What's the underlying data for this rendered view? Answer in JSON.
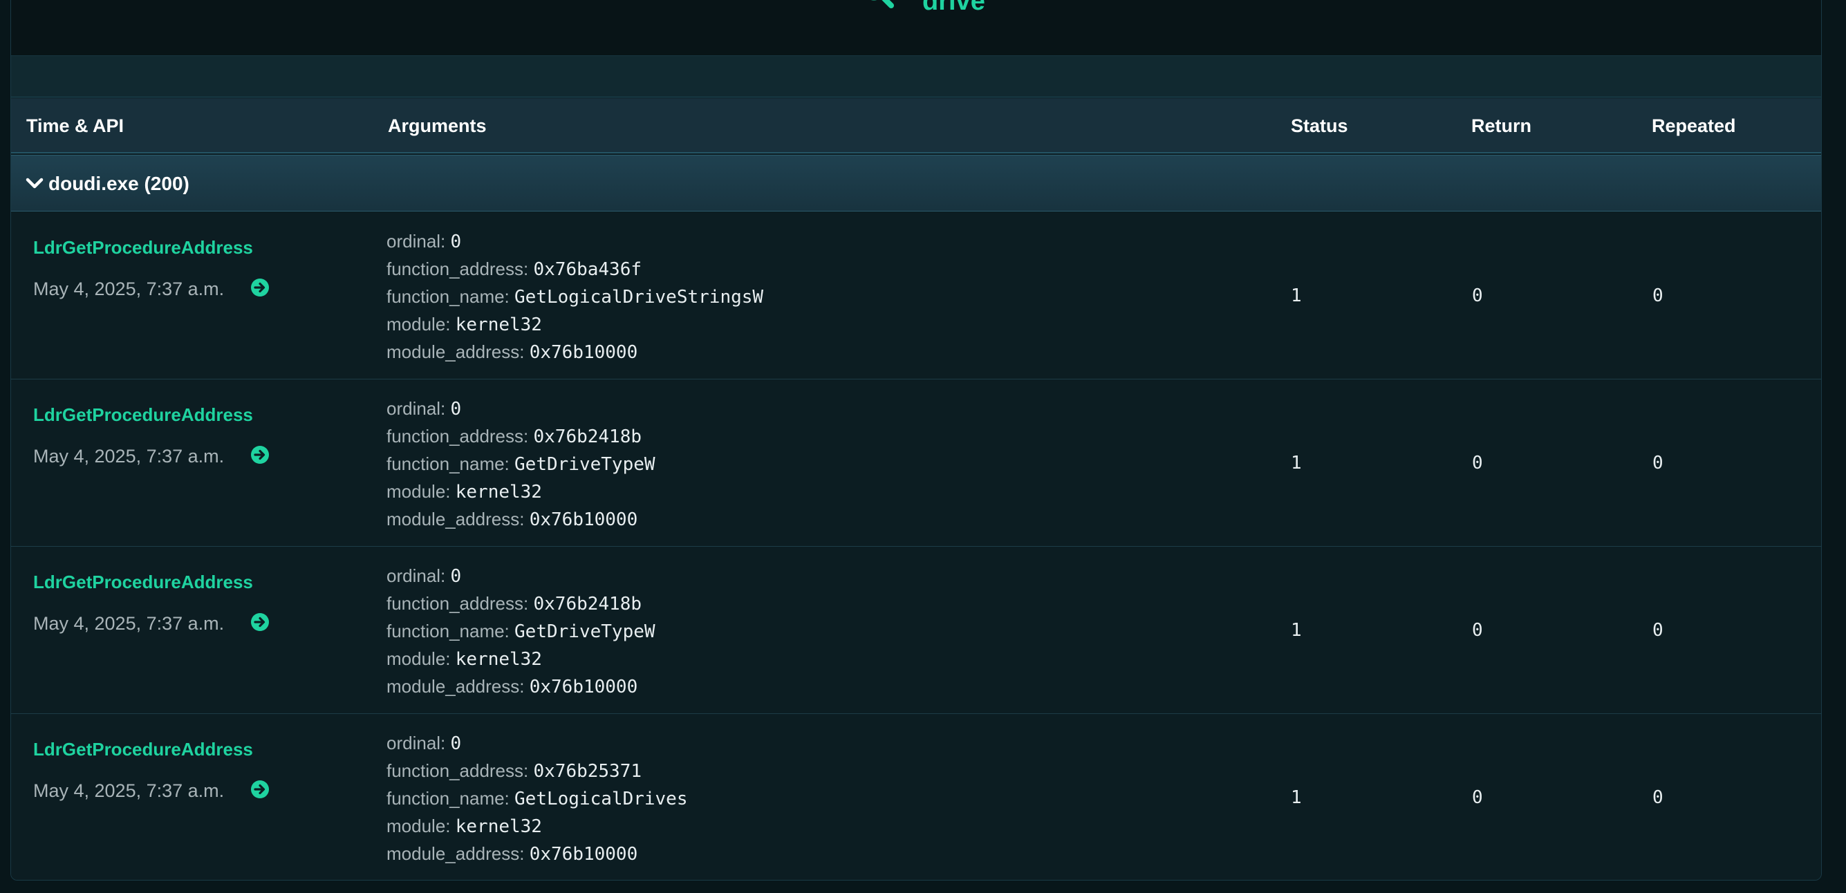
{
  "search": {
    "term": "drive"
  },
  "table": {
    "columns": {
      "time_api": "Time & API",
      "arguments": "Arguments",
      "status": "Status",
      "return": "Return",
      "repeated": "Repeated"
    },
    "group": {
      "label": "doudi.exe (200)"
    },
    "rows": [
      {
        "api": "LdrGetProcedureAddress",
        "time": "May 4, 2025, 7:37 a.m.",
        "args": [
          {
            "key": "ordinal:",
            "value": "0"
          },
          {
            "key": "function_address:",
            "value": "0x76ba436f"
          },
          {
            "key": "function_name:",
            "value": "GetLogicalDriveStringsW"
          },
          {
            "key": "module:",
            "value": "kernel32"
          },
          {
            "key": "module_address:",
            "value": "0x76b10000"
          }
        ],
        "status": "1",
        "return": "0",
        "repeated": "0"
      },
      {
        "api": "LdrGetProcedureAddress",
        "time": "May 4, 2025, 7:37 a.m.",
        "args": [
          {
            "key": "ordinal:",
            "value": "0"
          },
          {
            "key": "function_address:",
            "value": "0x76b2418b"
          },
          {
            "key": "function_name:",
            "value": "GetDriveTypeW"
          },
          {
            "key": "module:",
            "value": "kernel32"
          },
          {
            "key": "module_address:",
            "value": "0x76b10000"
          }
        ],
        "status": "1",
        "return": "0",
        "repeated": "0"
      },
      {
        "api": "LdrGetProcedureAddress",
        "time": "May 4, 2025, 7:37 a.m.",
        "args": [
          {
            "key": "ordinal:",
            "value": "0"
          },
          {
            "key": "function_address:",
            "value": "0x76b2418b"
          },
          {
            "key": "function_name:",
            "value": "GetDriveTypeW"
          },
          {
            "key": "module:",
            "value": "kernel32"
          },
          {
            "key": "module_address:",
            "value": "0x76b10000"
          }
        ],
        "status": "1",
        "return": "0",
        "repeated": "0"
      },
      {
        "api": "LdrGetProcedureAddress",
        "time": "May 4, 2025, 7:37 a.m.",
        "args": [
          {
            "key": "ordinal:",
            "value": "0"
          },
          {
            "key": "function_address:",
            "value": "0x76b25371"
          },
          {
            "key": "function_name:",
            "value": "GetLogicalDrives"
          },
          {
            "key": "module:",
            "value": "kernel32"
          },
          {
            "key": "module_address:",
            "value": "0x76b10000"
          }
        ],
        "status": "1",
        "return": "0",
        "repeated": "0"
      }
    ]
  },
  "colors": {
    "accent": "#1fd3a0",
    "background": "#0c1d22",
    "header": "#18303c",
    "group_row": "#1f4150",
    "muted_text": "#a9b4b8"
  },
  "icons": {
    "search": "search-icon",
    "group_toggle": "chevron-down-icon",
    "row_action": "arrow-right-circle-icon"
  }
}
